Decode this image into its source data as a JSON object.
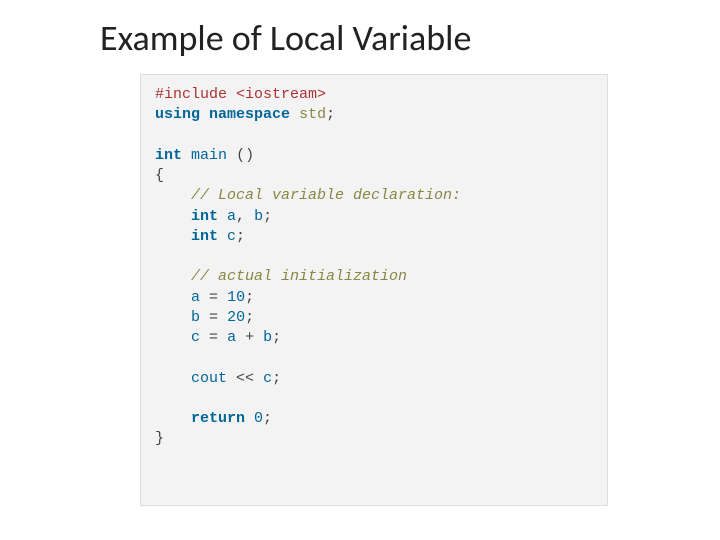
{
  "title": "Example of Local Variable",
  "code": {
    "pre_include": "#include",
    "include_target": "<iostream>",
    "kw_using": "using",
    "kw_namespace": "namespace",
    "id_std": "std",
    "semi": ";",
    "kw_int": "int",
    "id_main": "main",
    "paren_open": "(",
    "paren_close": ")",
    "brace_open": "{",
    "brace_close": "}",
    "cmt_decl": "// Local variable declaration:",
    "id_a": "a",
    "id_b": "b",
    "id_c": "c",
    "comma": ",",
    "cmt_init": "// actual initialization",
    "eq": "=",
    "num_10": "10",
    "num_20": "20",
    "plus": "+",
    "id_cout": "cout",
    "op_ins": "<<",
    "kw_return": "return",
    "num_0": "0"
  }
}
